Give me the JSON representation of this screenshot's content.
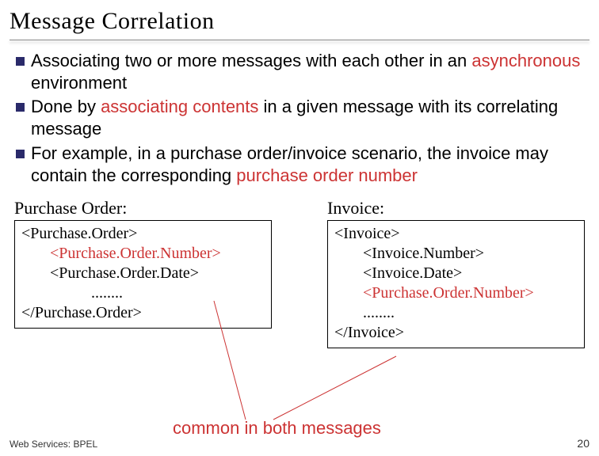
{
  "title": "Message Correlation",
  "bullets": [
    {
      "pre": "Associating two or more messages with each other in an ",
      "hl": "asynchronous",
      "post": " environment"
    },
    {
      "pre": "Done by ",
      "hl": "associating contents",
      "post": " in a given message with its correlating message"
    },
    {
      "pre": "For example, in a purchase order/invoice scenario, the invoice may contain the corresponding ",
      "hl": "purchase order number",
      "post": ""
    }
  ],
  "left_box": {
    "label": "Purchase Order:",
    "lines": [
      {
        "text": "<Purchase.Order>",
        "indent": 0,
        "hl": false
      },
      {
        "text": "<Purchase.Order.Number>",
        "indent": 1,
        "hl": true
      },
      {
        "text": "<Purchase.Order.Date>",
        "indent": 1,
        "hl": false
      },
      {
        "text": "........",
        "indent": 2,
        "hl": false
      },
      {
        "text": "</Purchase.Order>",
        "indent": 0,
        "hl": false
      }
    ]
  },
  "right_box": {
    "label": "Invoice:",
    "lines": [
      {
        "text": "<Invoice>",
        "indent": 0,
        "hl": false
      },
      {
        "text": "<Invoice.Number>",
        "indent": 1,
        "hl": false
      },
      {
        "text": "<Invoice.Date>",
        "indent": 1,
        "hl": false
      },
      {
        "text": "<Purchase.Order.Number>",
        "indent": 1,
        "hl": true
      },
      {
        "text": "........",
        "indent": 1,
        "hl": false
      },
      {
        "text": "</Invoice>",
        "indent": 0,
        "hl": false
      }
    ]
  },
  "common_label": "common in both messages",
  "footer_left": "Web Services: BPEL",
  "footer_right": "20"
}
